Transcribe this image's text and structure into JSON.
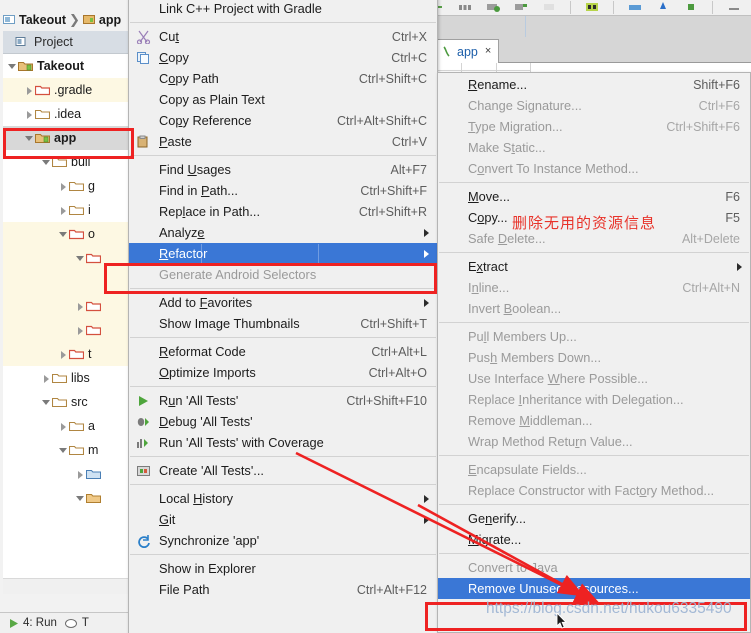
{
  "app": {
    "breadcrumb": [
      "Takeout",
      "app"
    ],
    "tool_window_title": "Project",
    "editor_tab": {
      "label": "app",
      "close": "×"
    },
    "status_run": "4: Run",
    "status_todo": "T"
  },
  "tree": [
    {
      "label": "Takeout",
      "indent": 0,
      "arrow": "expanded",
      "bold": true,
      "folder": "module",
      "row_bg": "#ffffff"
    },
    {
      "label": ".gradle",
      "indent": 1,
      "arrow": "collapsed",
      "bold": false,
      "folder": "excluded",
      "row_bg": "#fdf8e3"
    },
    {
      "label": ".idea",
      "indent": 1,
      "arrow": "collapsed",
      "bold": false,
      "folder": "plain",
      "row_bg": "#ffffff"
    },
    {
      "label": "app",
      "indent": 1,
      "arrow": "expanded",
      "bold": true,
      "folder": "module",
      "row_bg": "#d8d8d8"
    },
    {
      "label": "buil",
      "indent": 2,
      "arrow": "expanded",
      "bold": false,
      "folder": "plain",
      "row_bg": "#ffffff"
    },
    {
      "label": "g",
      "indent": 3,
      "arrow": "collapsed",
      "bold": false,
      "folder": "plain",
      "row_bg": "#ffffff"
    },
    {
      "label": "i",
      "indent": 3,
      "arrow": "collapsed",
      "bold": false,
      "folder": "plain",
      "row_bg": "#ffffff"
    },
    {
      "label": "o",
      "indent": 3,
      "arrow": "expanded",
      "bold": false,
      "folder": "excluded",
      "row_bg": "#fdf8e3"
    },
    {
      "label": "",
      "indent": 4,
      "arrow": "expanded",
      "bold": false,
      "folder": "excluded",
      "row_bg": "#fdf8e3"
    },
    {
      "label": "",
      "indent": 5,
      "arrow": "none",
      "bold": false,
      "folder": "none",
      "row_bg": "#fdf8e3"
    },
    {
      "label": "",
      "indent": 4,
      "arrow": "collapsed",
      "bold": false,
      "folder": "excluded",
      "row_bg": "#fdf8e3"
    },
    {
      "label": "",
      "indent": 4,
      "arrow": "collapsed",
      "bold": false,
      "folder": "excluded",
      "row_bg": "#fdf8e3"
    },
    {
      "label": "t",
      "indent": 3,
      "arrow": "collapsed",
      "bold": false,
      "folder": "excluded",
      "row_bg": "#fdf8e3"
    },
    {
      "label": "libs",
      "indent": 2,
      "arrow": "collapsed",
      "bold": false,
      "folder": "plain",
      "row_bg": "#ffffff"
    },
    {
      "label": "src",
      "indent": 2,
      "arrow": "expanded",
      "bold": false,
      "folder": "plain",
      "row_bg": "#ffffff"
    },
    {
      "label": "a",
      "indent": 3,
      "arrow": "collapsed",
      "bold": false,
      "folder": "plain",
      "row_bg": "#ffffff"
    },
    {
      "label": "m",
      "indent": 3,
      "arrow": "expanded",
      "bold": false,
      "folder": "plain",
      "row_bg": "#ffffff"
    },
    {
      "label": "",
      "indent": 4,
      "arrow": "collapsed",
      "bold": false,
      "folder": "source",
      "row_bg": "#ffffff"
    },
    {
      "label": "",
      "indent": 4,
      "arrow": "expanded",
      "bold": false,
      "folder": "res",
      "row_bg": "#ffffff"
    }
  ],
  "menu_main": {
    "name": "project-context-menu",
    "items": [
      {
        "label": "Link C++ Project with Gradle",
        "key": "",
        "state": "normal",
        "icon": "none",
        "mnemonic": -1
      },
      {
        "sep": true
      },
      {
        "label": "Cut",
        "key": "Ctrl+X",
        "state": "normal",
        "icon": "scissors",
        "mnemonic": 2
      },
      {
        "label": "Copy",
        "key": "Ctrl+C",
        "state": "normal",
        "icon": "copy",
        "mnemonic": 0
      },
      {
        "label": "Copy Path",
        "key": "Ctrl+Shift+C",
        "state": "normal",
        "icon": "none",
        "mnemonic": 1
      },
      {
        "label": "Copy as Plain Text",
        "key": "",
        "state": "normal",
        "icon": "none",
        "mnemonic": -1
      },
      {
        "label": "Copy Reference",
        "key": "Ctrl+Alt+Shift+C",
        "state": "normal",
        "icon": "none",
        "mnemonic": 2
      },
      {
        "label": "Paste",
        "key": "Ctrl+V",
        "state": "normal",
        "icon": "paste",
        "mnemonic": 0
      },
      {
        "sep": true
      },
      {
        "label": "Find Usages",
        "key": "Alt+F7",
        "state": "normal",
        "icon": "none",
        "mnemonic": 5
      },
      {
        "label": "Find in Path...",
        "key": "Ctrl+Shift+F",
        "state": "normal",
        "icon": "none",
        "mnemonic": 8
      },
      {
        "label": "Replace in Path...",
        "key": "Ctrl+Shift+R",
        "state": "normal",
        "icon": "none",
        "mnemonic": 3
      },
      {
        "label": "Analyze",
        "key": "",
        "state": "normal",
        "icon": "none",
        "submenu": true,
        "mnemonic": 6
      },
      {
        "label": "Refactor",
        "key": "",
        "state": "selected",
        "icon": "none",
        "submenu": true,
        "mnemonic": 0
      },
      {
        "label": "Generate Android Selectors",
        "key": "",
        "state": "disabled",
        "icon": "none",
        "mnemonic": -1
      },
      {
        "sep": true
      },
      {
        "label": "Add to Favorites",
        "key": "",
        "state": "normal",
        "icon": "none",
        "submenu": true,
        "mnemonic": 7
      },
      {
        "label": "Show Image Thumbnails",
        "key": "Ctrl+Shift+T",
        "state": "normal",
        "icon": "none",
        "mnemonic": -1
      },
      {
        "sep": true
      },
      {
        "label": "Reformat Code",
        "key": "Ctrl+Alt+L",
        "state": "normal",
        "icon": "none",
        "mnemonic": 0
      },
      {
        "label": "Optimize Imports",
        "key": "Ctrl+Alt+O",
        "state": "normal",
        "icon": "none",
        "mnemonic": 0
      },
      {
        "sep": true
      },
      {
        "label": "Run 'All Tests'",
        "key": "Ctrl+Shift+F10",
        "state": "normal",
        "icon": "run",
        "mnemonic": 1
      },
      {
        "label": "Debug 'All Tests'",
        "key": "",
        "state": "normal",
        "icon": "debug",
        "mnemonic": 0
      },
      {
        "label": "Run 'All Tests' with Coverage",
        "key": "",
        "state": "normal",
        "icon": "coverage",
        "mnemonic": -1
      },
      {
        "sep": true
      },
      {
        "label": "Create 'All Tests'...",
        "key": "",
        "state": "normal",
        "icon": "create",
        "mnemonic": -1
      },
      {
        "sep": true
      },
      {
        "label": "Local History",
        "key": "",
        "state": "normal",
        "icon": "none",
        "submenu": true,
        "mnemonic": 6
      },
      {
        "label": "Git",
        "key": "",
        "state": "normal",
        "icon": "none",
        "submenu": true,
        "mnemonic": 0
      },
      {
        "label": "Synchronize 'app'",
        "key": "",
        "state": "normal",
        "icon": "sync",
        "mnemonic": -1
      },
      {
        "sep": true
      },
      {
        "label": "Show in Explorer",
        "key": "",
        "state": "normal",
        "icon": "none",
        "mnemonic": -1
      },
      {
        "label": "File Path",
        "key": "Ctrl+Alt+F12",
        "state": "normal",
        "icon": "none",
        "mnemonic": -1
      }
    ]
  },
  "menu_refactor": {
    "name": "refactor-submenu",
    "items": [
      {
        "label": "Rename...",
        "key": "Shift+F6",
        "state": "normal",
        "mnemonic": 0
      },
      {
        "label": "Change Signature...",
        "key": "Ctrl+F6",
        "state": "disabled",
        "mnemonic": 4
      },
      {
        "label": "Type Migration...",
        "key": "Ctrl+Shift+F6",
        "state": "disabled",
        "mnemonic": 0
      },
      {
        "label": "Make Static...",
        "key": "",
        "state": "disabled",
        "mnemonic": 6
      },
      {
        "label": "Convert To Instance Method...",
        "key": "",
        "state": "disabled",
        "mnemonic": 1
      },
      {
        "sep": true
      },
      {
        "label": "Move...",
        "key": "F6",
        "state": "normal",
        "mnemonic": 0
      },
      {
        "label": "Copy...",
        "key": "F5",
        "state": "normal",
        "mnemonic": 1
      },
      {
        "label": "Safe Delete...",
        "key": "Alt+Delete",
        "state": "disabled",
        "mnemonic": 5
      },
      {
        "sep": true
      },
      {
        "label": "Extract",
        "key": "",
        "state": "normal",
        "submenu": true,
        "mnemonic": 1
      },
      {
        "label": "Inline...",
        "key": "Ctrl+Alt+N",
        "state": "disabled",
        "mnemonic": 1
      },
      {
        "label": "Invert Boolean...",
        "key": "",
        "state": "disabled",
        "mnemonic": 7
      },
      {
        "sep": true
      },
      {
        "label": "Pull Members Up...",
        "key": "",
        "state": "disabled",
        "mnemonic": 2
      },
      {
        "label": "Push Members Down...",
        "key": "",
        "state": "disabled",
        "mnemonic": 3
      },
      {
        "label": "Use Interface Where Possible...",
        "key": "",
        "state": "disabled",
        "mnemonic": 14
      },
      {
        "label": "Replace Inheritance with Delegation...",
        "key": "",
        "state": "disabled",
        "mnemonic": 8
      },
      {
        "label": "Remove Middleman...",
        "key": "",
        "state": "disabled",
        "mnemonic": 7
      },
      {
        "label": "Wrap Method Return Value...",
        "key": "",
        "state": "disabled",
        "mnemonic": 16
      },
      {
        "sep": true
      },
      {
        "label": "Encapsulate Fields...",
        "key": "",
        "state": "disabled",
        "mnemonic": 0
      },
      {
        "label": "Replace Constructor with Factory Method...",
        "key": "",
        "state": "disabled",
        "mnemonic": 29
      },
      {
        "sep": true
      },
      {
        "label": "Generify...",
        "key": "",
        "state": "normal",
        "mnemonic": 2
      },
      {
        "label": "Migrate...",
        "key": "",
        "state": "normal",
        "mnemonic": 0
      },
      {
        "sep": true
      },
      {
        "label": "Convert to Java",
        "key": "",
        "state": "disabled",
        "mnemonic": -1
      },
      {
        "label": "Remove Unused Resources...",
        "key": "",
        "state": "selected",
        "mnemonic": -1
      }
    ]
  },
  "annotations": {
    "chinese_note": "删除无用的资源信息",
    "watermark": "https://blog.csdn.net/hukou6335490",
    "highlight_color": "#ee2222",
    "selection_color": "#3a77d6",
    "note_color": "#e8332a"
  }
}
